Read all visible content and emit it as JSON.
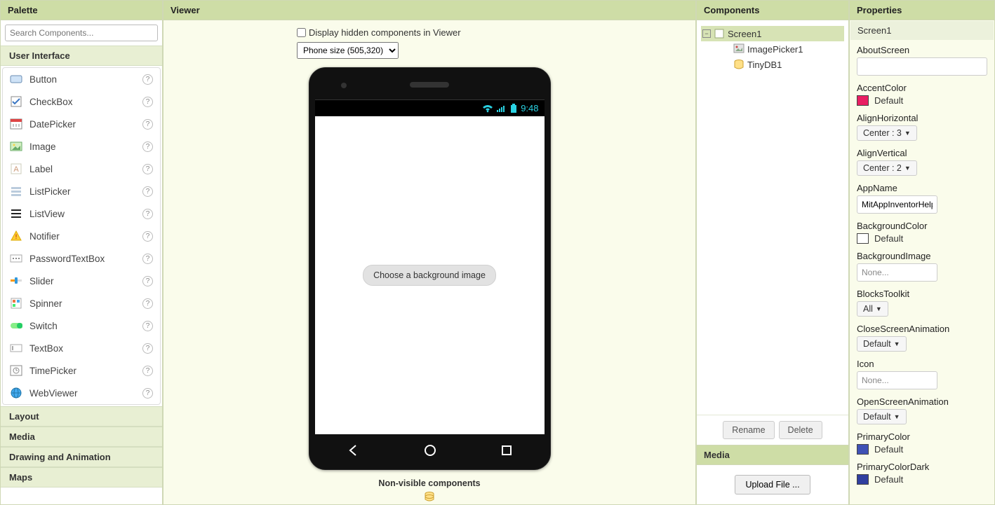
{
  "palette": {
    "title": "Palette",
    "search_placeholder": "Search Components...",
    "categories": {
      "ui": "User Interface",
      "layout": "Layout",
      "media": "Media",
      "drawing": "Drawing and Animation",
      "maps": "Maps"
    },
    "items": [
      {
        "label": "Button"
      },
      {
        "label": "CheckBox"
      },
      {
        "label": "DatePicker"
      },
      {
        "label": "Image"
      },
      {
        "label": "Label"
      },
      {
        "label": "ListPicker"
      },
      {
        "label": "ListView"
      },
      {
        "label": "Notifier"
      },
      {
        "label": "PasswordTextBox"
      },
      {
        "label": "Slider"
      },
      {
        "label": "Spinner"
      },
      {
        "label": "Switch"
      },
      {
        "label": "TextBox"
      },
      {
        "label": "TimePicker"
      },
      {
        "label": "WebViewer"
      }
    ]
  },
  "viewer": {
    "title": "Viewer",
    "hidden_checkbox": "Display hidden components in Viewer",
    "phone_size": "Phone size (505,320)",
    "clock": "9:48",
    "picker_button": "Choose a background image",
    "nonvisible_label": "Non-visible components"
  },
  "components": {
    "title": "Components",
    "rename": "Rename",
    "delete": "Delete",
    "tree": {
      "screen": "Screen1",
      "image_picker": "ImagePicker1",
      "tinydb": "TinyDB1"
    },
    "media_title": "Media",
    "upload": "Upload File ..."
  },
  "properties": {
    "title": "Properties",
    "selected": "Screen1",
    "rows": {
      "AboutScreen": {
        "label": "AboutScreen",
        "value": ""
      },
      "AccentColor": {
        "label": "AccentColor",
        "value": "Default"
      },
      "AlignHorizontal": {
        "label": "AlignHorizontal",
        "value": "Center : 3"
      },
      "AlignVertical": {
        "label": "AlignVertical",
        "value": "Center : 2"
      },
      "AppName": {
        "label": "AppName",
        "value": "MitAppInventorHelp"
      },
      "BackgroundColor": {
        "label": "BackgroundColor",
        "value": "Default"
      },
      "BackgroundImage": {
        "label": "BackgroundImage",
        "value": "None..."
      },
      "BlocksToolkit": {
        "label": "BlocksToolkit",
        "value": "All"
      },
      "CloseScreenAnimation": {
        "label": "CloseScreenAnimation",
        "value": "Default"
      },
      "Icon": {
        "label": "Icon",
        "value": "None..."
      },
      "OpenScreenAnimation": {
        "label": "OpenScreenAnimation",
        "value": "Default"
      },
      "PrimaryColor": {
        "label": "PrimaryColor",
        "value": "Default"
      },
      "PrimaryColorDark": {
        "label": "PrimaryColorDark",
        "value": "Default"
      }
    }
  }
}
